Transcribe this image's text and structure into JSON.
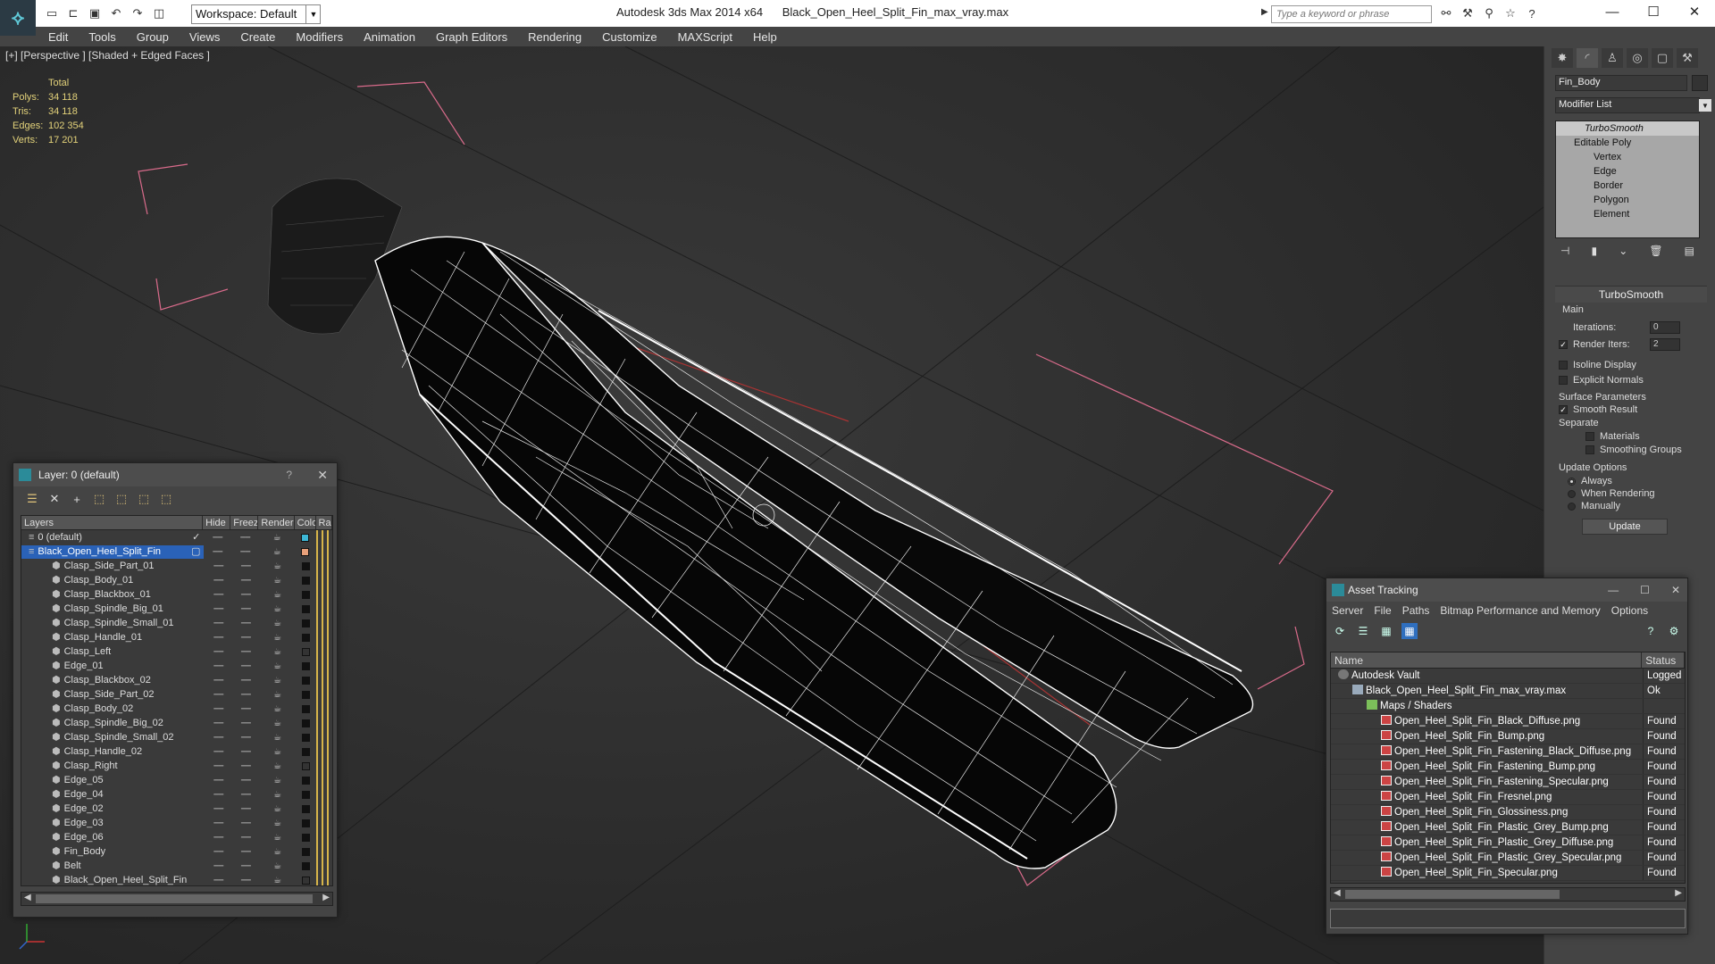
{
  "title_bar": {
    "app_name": "Autodesk 3ds Max  2014 x64",
    "file_name": "Black_Open_Heel_Split_Fin_max_vray.max",
    "workspace": "Workspace: Default",
    "search_placeholder": "Type a keyword or phrase"
  },
  "menu": [
    "Edit",
    "Tools",
    "Group",
    "Views",
    "Create",
    "Modifiers",
    "Animation",
    "Graph Editors",
    "Rendering",
    "Customize",
    "MAXScript",
    "Help"
  ],
  "viewport": {
    "label": "[+] [Perspective ] [Shaded + Edged Faces ]",
    "stats": {
      "header": "Total",
      "rows": [
        {
          "key": "Polys:",
          "value": "34 118"
        },
        {
          "key": "Tris:",
          "value": "34 118"
        },
        {
          "key": "Edges:",
          "value": "102 354"
        },
        {
          "key": "Verts:",
          "value": "17 201"
        }
      ]
    }
  },
  "command_panel": {
    "object_name": "Fin_Body",
    "modifier_list": "Modifier List",
    "stack": {
      "top": "TurboSmooth",
      "base": "Editable Poly",
      "subs": [
        "Vertex",
        "Edge",
        "Border",
        "Polygon",
        "Element"
      ]
    },
    "turbosmooth": {
      "title": "TurboSmooth",
      "main_label": "Main",
      "iterations_label": "Iterations:",
      "iterations_value": "0",
      "render_iters_label": "Render Iters:",
      "render_iters_value": "2",
      "isoline_label": "Isoline Display",
      "explicit_label": "Explicit Normals",
      "surface_label": "Surface Parameters",
      "smooth_label": "Smooth Result",
      "separate_label": "Separate",
      "materials_label": "Materials",
      "smoothing_label": "Smoothing Groups",
      "update_options_label": "Update Options",
      "always_label": "Always",
      "when_rendering_label": "When Rendering",
      "manually_label": "Manually",
      "update_button": "Update"
    }
  },
  "layer_dialog": {
    "title": "Layer: 0 (default)",
    "help": "?",
    "columns": [
      "Layers",
      "Hide",
      "Freeze",
      "Render",
      "Color",
      "Radio"
    ],
    "rows": [
      {
        "name": "0 (default)",
        "level": 0,
        "color": "#3db7d6",
        "selected": false,
        "checked": true
      },
      {
        "name": "Black_Open_Heel_Split_Fin",
        "level": 0,
        "color": "#e8a07a",
        "selected": true,
        "checked": false
      },
      {
        "name": "Clasp_Side_Part_01",
        "level": 1,
        "color": "#111111"
      },
      {
        "name": "Clasp_Body_01",
        "level": 1,
        "color": "#111111"
      },
      {
        "name": "Clasp_Blackbox_01",
        "level": 1,
        "color": "#111111"
      },
      {
        "name": "Clasp_Spindle_Big_01",
        "level": 1,
        "color": "#111111"
      },
      {
        "name": "Clasp_Spindle_Small_01",
        "level": 1,
        "color": "#111111"
      },
      {
        "name": "Clasp_Handle_01",
        "level": 1,
        "color": "#111111"
      },
      {
        "name": "Clasp_Left",
        "level": 1,
        "color": "#333333"
      },
      {
        "name": "Edge_01",
        "level": 1,
        "color": "#111111"
      },
      {
        "name": "Clasp_Blackbox_02",
        "level": 1,
        "color": "#111111"
      },
      {
        "name": "Clasp_Side_Part_02",
        "level": 1,
        "color": "#111111"
      },
      {
        "name": "Clasp_Body_02",
        "level": 1,
        "color": "#111111"
      },
      {
        "name": "Clasp_Spindle_Big_02",
        "level": 1,
        "color": "#111111"
      },
      {
        "name": "Clasp_Spindle_Small_02",
        "level": 1,
        "color": "#111111"
      },
      {
        "name": "Clasp_Handle_02",
        "level": 1,
        "color": "#111111"
      },
      {
        "name": "Clasp_Right",
        "level": 1,
        "color": "#333333"
      },
      {
        "name": "Edge_05",
        "level": 1,
        "color": "#111111"
      },
      {
        "name": "Edge_04",
        "level": 1,
        "color": "#111111"
      },
      {
        "name": "Edge_02",
        "level": 1,
        "color": "#111111"
      },
      {
        "name": "Edge_03",
        "level": 1,
        "color": "#111111"
      },
      {
        "name": "Edge_06",
        "level": 1,
        "color": "#111111"
      },
      {
        "name": "Fin_Body",
        "level": 1,
        "color": "#111111"
      },
      {
        "name": "Belt",
        "level": 1,
        "color": "#111111"
      },
      {
        "name": "Black_Open_Heel_Split_Fin",
        "level": 1,
        "color": "#333333"
      }
    ]
  },
  "asset_tracking": {
    "title": "Asset Tracking",
    "menu": [
      "Server",
      "File",
      "Paths",
      "Bitmap Performance and Memory",
      "Options"
    ],
    "columns": [
      "Name",
      "Status"
    ],
    "rows": [
      {
        "name": "Autodesk Vault",
        "status": "Logged",
        "level": 0,
        "icon": "vault"
      },
      {
        "name": "Black_Open_Heel_Split_Fin_max_vray.max",
        "status": "Ok",
        "level": 1,
        "icon": "max"
      },
      {
        "name": "Maps / Shaders",
        "status": "",
        "level": 2,
        "icon": "folder"
      },
      {
        "name": "Open_Heel_Split_Fin_Black_Diffuse.png",
        "status": "Found",
        "level": 3,
        "icon": "png"
      },
      {
        "name": "Open_Heel_Split_Fin_Bump.png",
        "status": "Found",
        "level": 3,
        "icon": "png"
      },
      {
        "name": "Open_Heel_Split_Fin_Fastening_Black_Diffuse.png",
        "status": "Found",
        "level": 3,
        "icon": "png"
      },
      {
        "name": "Open_Heel_Split_Fin_Fastening_Bump.png",
        "status": "Found",
        "level": 3,
        "icon": "png"
      },
      {
        "name": "Open_Heel_Split_Fin_Fastening_Specular.png",
        "status": "Found",
        "level": 3,
        "icon": "png"
      },
      {
        "name": "Open_Heel_Split_Fin_Fresnel.png",
        "status": "Found",
        "level": 3,
        "icon": "png"
      },
      {
        "name": "Open_Heel_Split_Fin_Glossiness.png",
        "status": "Found",
        "level": 3,
        "icon": "png"
      },
      {
        "name": "Open_Heel_Split_Fin_Plastic_Grey_Bump.png",
        "status": "Found",
        "level": 3,
        "icon": "png"
      },
      {
        "name": "Open_Heel_Split_Fin_Plastic_Grey_Diffuse.png",
        "status": "Found",
        "level": 3,
        "icon": "png"
      },
      {
        "name": "Open_Heel_Split_Fin_Plastic_Grey_Specular.png",
        "status": "Found",
        "level": 3,
        "icon": "png"
      },
      {
        "name": "Open_Heel_Split_Fin_Specular.png",
        "status": "Found",
        "level": 3,
        "icon": "png"
      }
    ]
  }
}
